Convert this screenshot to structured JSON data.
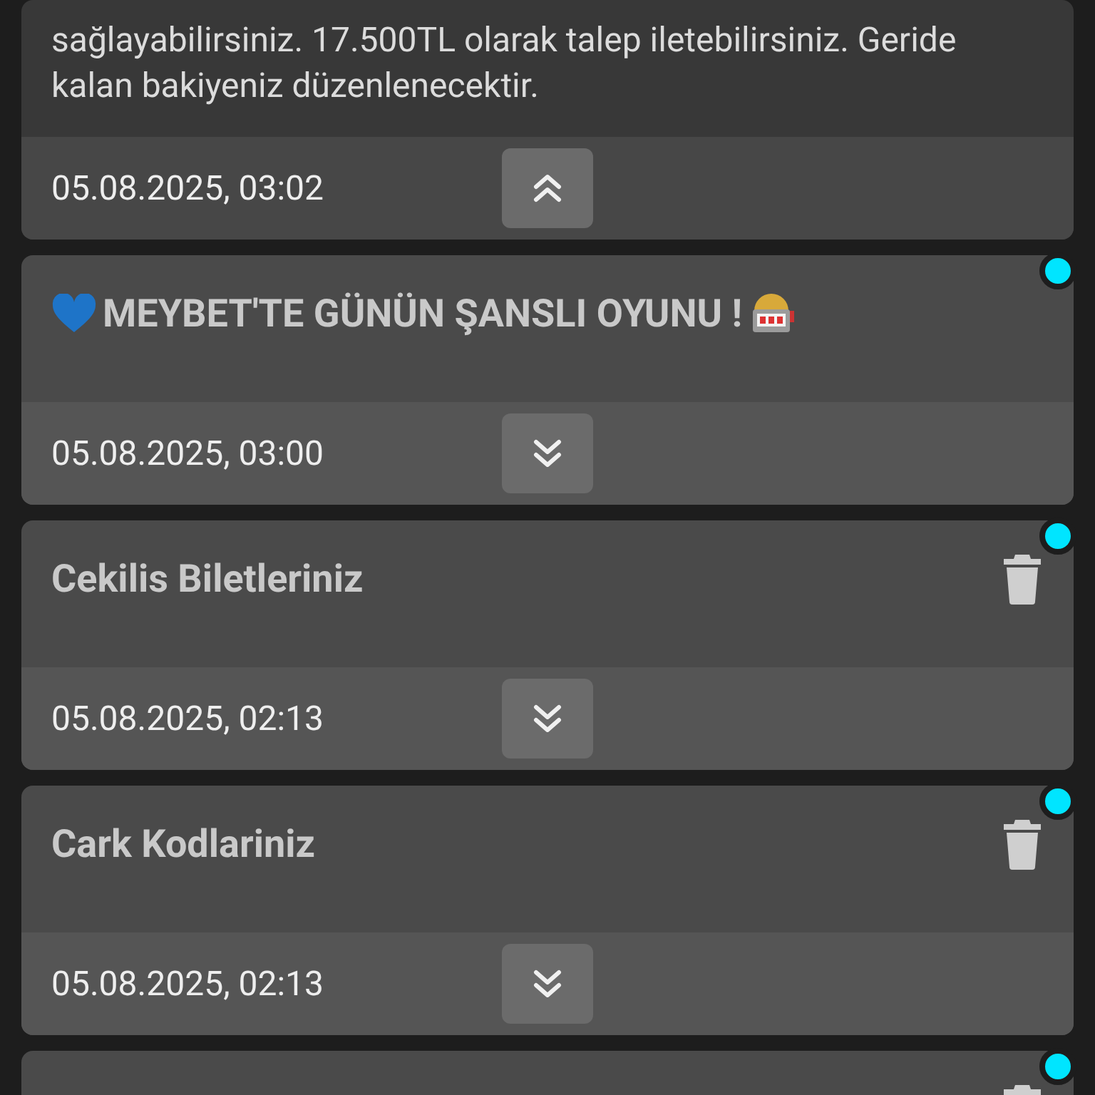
{
  "notifications": [
    {
      "kind": "plain",
      "body_lines": [
        "sağlayabilirsiniz. 17.500TL olarak talep iletebilirsiniz. Geride",
        "kalan bakiyeniz düzenlenecektir."
      ],
      "date": "05.08.2025, 03:02",
      "expanded": true,
      "unread": false,
      "deletable": false
    },
    {
      "kind": "promo",
      "title": "MEYBET'TE GÜNÜN ŞANSLI OYUNU !",
      "date": "05.08.2025, 03:00",
      "expanded": false,
      "unread": true,
      "deletable": false
    },
    {
      "kind": "plain",
      "title": "Cekilis Biletleriniz",
      "date": "05.08.2025, 02:13",
      "expanded": false,
      "unread": true,
      "deletable": true
    },
    {
      "kind": "plain",
      "title": "Cark Kodlariniz",
      "date": "05.08.2025, 02:13",
      "expanded": false,
      "unread": true,
      "deletable": true
    },
    {
      "kind": "plain",
      "unread": true,
      "deletable": true
    }
  ]
}
